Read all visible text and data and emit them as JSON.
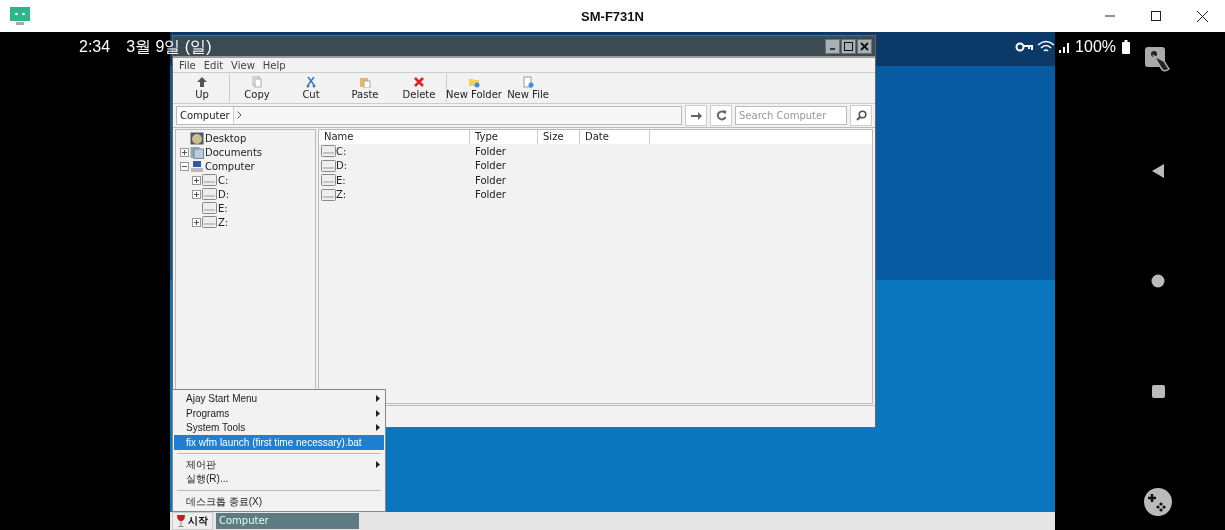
{
  "window": {
    "title": "SM-F731N"
  },
  "status_bar": {
    "time": "2:34",
    "date": "3월 9일 (일)",
    "battery": "100%"
  },
  "file_manager": {
    "menu": [
      "File",
      "Edit",
      "View",
      "Help"
    ],
    "toolbar": [
      {
        "label": "Up",
        "separator_after": true
      },
      {
        "label": "Copy",
        "separator_after": false
      },
      {
        "label": "Cut",
        "separator_after": false
      },
      {
        "label": "Paste",
        "separator_after": false
      },
      {
        "label": "Delete",
        "separator_after": true
      },
      {
        "label": "New Folder",
        "separator_after": false
      },
      {
        "label": "New File",
        "separator_after": false
      }
    ],
    "path": [
      "Computer"
    ],
    "search": {
      "placeholder": "Search Computer"
    },
    "tree": [
      {
        "label": "Desktop",
        "kind": "desktop",
        "expandable": false
      },
      {
        "label": "Documents",
        "kind": "documents",
        "expandable": true,
        "expanded": false
      },
      {
        "label": "Computer",
        "kind": "computer",
        "expandable": true,
        "expanded": true,
        "children": [
          {
            "label": "C:",
            "kind": "drive",
            "expandable": true,
            "expanded": false
          },
          {
            "label": "D:",
            "kind": "drive",
            "expandable": true,
            "expanded": false
          },
          {
            "label": "E:",
            "kind": "drive",
            "expandable": false
          },
          {
            "label": "Z:",
            "kind": "drive",
            "expandable": true,
            "expanded": false
          }
        ]
      }
    ],
    "columns": [
      "Name",
      "Type",
      "Size",
      "Date"
    ],
    "rows": [
      {
        "name": "C:",
        "type": "Folder"
      },
      {
        "name": "D:",
        "type": "Folder"
      },
      {
        "name": "E:",
        "type": "Folder"
      },
      {
        "name": "Z:",
        "type": "Folder"
      }
    ]
  },
  "start_menu": {
    "items": [
      {
        "kind": "item",
        "label": "Ajay Start Menu",
        "submenu": true,
        "selected": false
      },
      {
        "kind": "item",
        "label": "Programs",
        "submenu": true,
        "selected": false
      },
      {
        "kind": "item",
        "label": "System Tools",
        "submenu": true,
        "selected": false
      },
      {
        "kind": "item",
        "label": "fix wfm launch (first time necessary).bat",
        "submenu": false,
        "selected": true
      },
      {
        "kind": "separator"
      },
      {
        "kind": "item",
        "label": "제어판",
        "submenu": true,
        "selected": false
      },
      {
        "kind": "item",
        "label": "실행(R)...",
        "submenu": false,
        "selected": false
      },
      {
        "kind": "separator"
      },
      {
        "kind": "item",
        "label": "데스크톱 종료(X)",
        "submenu": false,
        "selected": false
      }
    ]
  },
  "taskbar": {
    "start": "시작",
    "tasks": [
      {
        "label": "Computer",
        "selected": true
      }
    ]
  }
}
